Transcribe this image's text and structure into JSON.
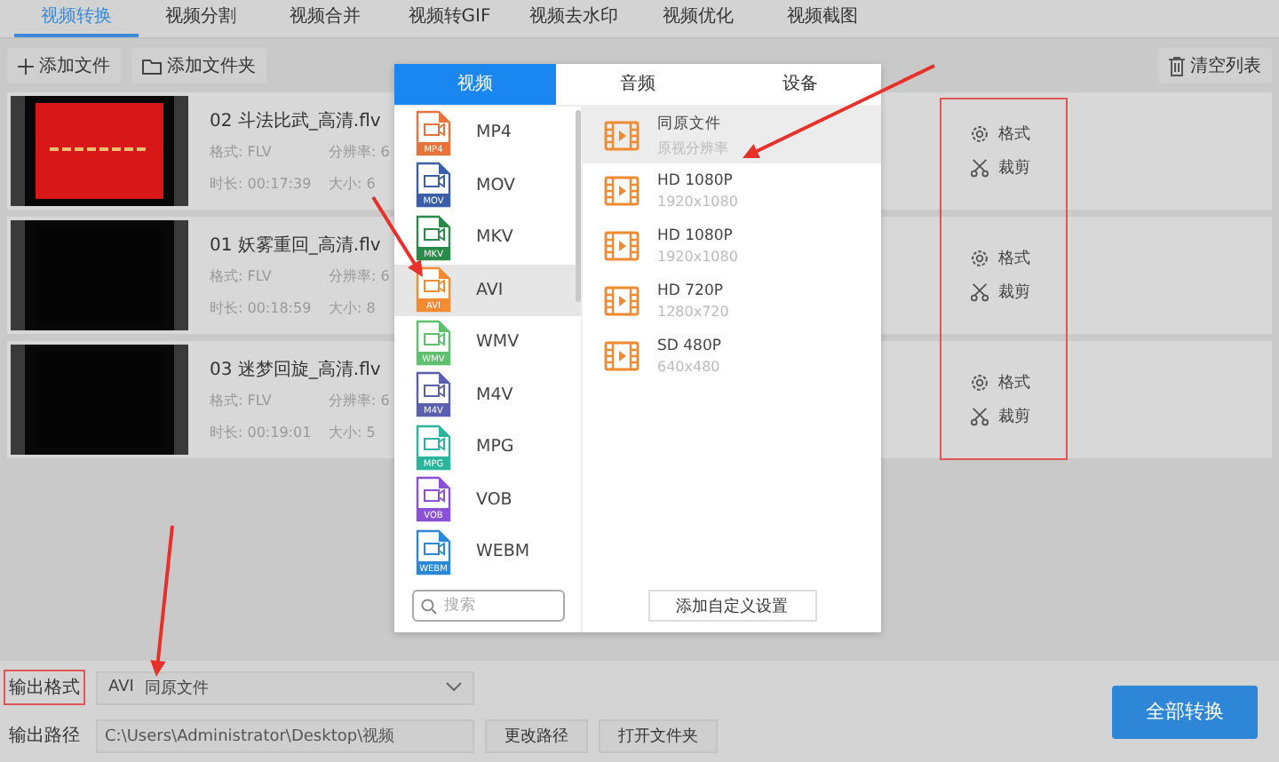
{
  "tabs": [
    {
      "label": "视频转换",
      "selected": true
    },
    {
      "label": "视频分割",
      "selected": false
    },
    {
      "label": "视频合并",
      "selected": false
    },
    {
      "label": "视频转GIF",
      "selected": false
    },
    {
      "label": "视频去水印",
      "selected": false
    },
    {
      "label": "视频优化",
      "selected": false
    },
    {
      "label": "视频截图",
      "selected": false
    }
  ],
  "toolbar": {
    "add_file": "添加文件",
    "add_folder": "添加文件夹",
    "clear_list": "清空列表"
  },
  "files": [
    {
      "name": "02 斗法比武_高清.flv",
      "format": "格式: FLV",
      "resolution": "分辨率: 6",
      "duration": "时长: 00:17:39",
      "size": "大小: 6",
      "thumbnail": {
        "kind": "picture",
        "color": "#d81818"
      },
      "actions": [
        {
          "kind": "format",
          "label": "格式"
        },
        {
          "kind": "cut",
          "label": "裁剪"
        }
      ]
    },
    {
      "name": "01 妖雾重回_高清.flv",
      "format": "格式: FLV",
      "resolution": "分辨率: 6",
      "duration": "时长: 00:18:59",
      "size": "大小: 8",
      "thumbnail": {
        "kind": "picture",
        "color": "#050505"
      },
      "actions": [
        {
          "kind": "format",
          "label": "格式"
        },
        {
          "kind": "cut",
          "label": "裁剪"
        }
      ]
    },
    {
      "name": "03 迷梦回旋_高清.flv",
      "format": "格式: FLV",
      "resolution": "分辨率: 6",
      "duration": "时长: 00:19:01",
      "size": "大小: 5",
      "thumbnail": {
        "kind": "picture",
        "color": "#050505"
      },
      "actions": [
        {
          "kind": "format",
          "label": "格式"
        },
        {
          "kind": "cut",
          "label": "裁剪"
        }
      ]
    }
  ],
  "actions_highlighted": true,
  "format_popup": {
    "tabs": [
      {
        "label": "视频",
        "selected": true
      },
      {
        "label": "音频",
        "selected": false
      },
      {
        "label": "设备",
        "selected": false
      }
    ],
    "formats": [
      {
        "name": "MP4",
        "badge": "MP4",
        "color": "#e8733a",
        "selected": false
      },
      {
        "name": "MOV",
        "badge": "MOV",
        "color": "#3a5ea8",
        "selected": false
      },
      {
        "name": "MKV",
        "badge": "MKV",
        "color": "#2a8a4a",
        "selected": false
      },
      {
        "name": "AVI",
        "badge": "AVI",
        "color": "#f28b32",
        "selected": true
      },
      {
        "name": "WMV",
        "badge": "WMV",
        "color": "#5cc06c",
        "selected": false
      },
      {
        "name": "M4V",
        "badge": "M4V",
        "color": "#5a5fb0",
        "selected": false
      },
      {
        "name": "MPG",
        "badge": "MPG",
        "color": "#2bb59e",
        "selected": false
      },
      {
        "name": "VOB",
        "badge": "VOB",
        "color": "#8a50d8",
        "selected": false
      },
      {
        "name": "WEBM",
        "badge": "WEBM",
        "color": "#2a88d8",
        "selected": false
      }
    ],
    "search": {
      "placeholder": "搜索"
    },
    "presets": [
      {
        "title": "同原文件",
        "detail": "原视分辨率",
        "selected": true
      },
      {
        "title": "HD 1080P",
        "detail": "1920x1080",
        "selected": false
      },
      {
        "title": "HD 1080P",
        "detail": "1920x1080",
        "selected": false
      },
      {
        "title": "HD 720P",
        "detail": "1280x720",
        "selected": false
      },
      {
        "title": "SD 480P",
        "detail": "640x480",
        "selected": false
      }
    ],
    "custom_button": "添加自定义设置"
  },
  "output": {
    "format_label": "输出格式",
    "format_label_highlighted": true,
    "format_value": "AVI",
    "format_detail": "同原文件",
    "path_label": "输出路径",
    "path_value": "C:\\Users\\Administrator\\Desktop\\视频",
    "change_path": "更改路径",
    "open_folder": "打开文件夹"
  },
  "convert_all": "全部转换",
  "annotation_arrows": true
}
